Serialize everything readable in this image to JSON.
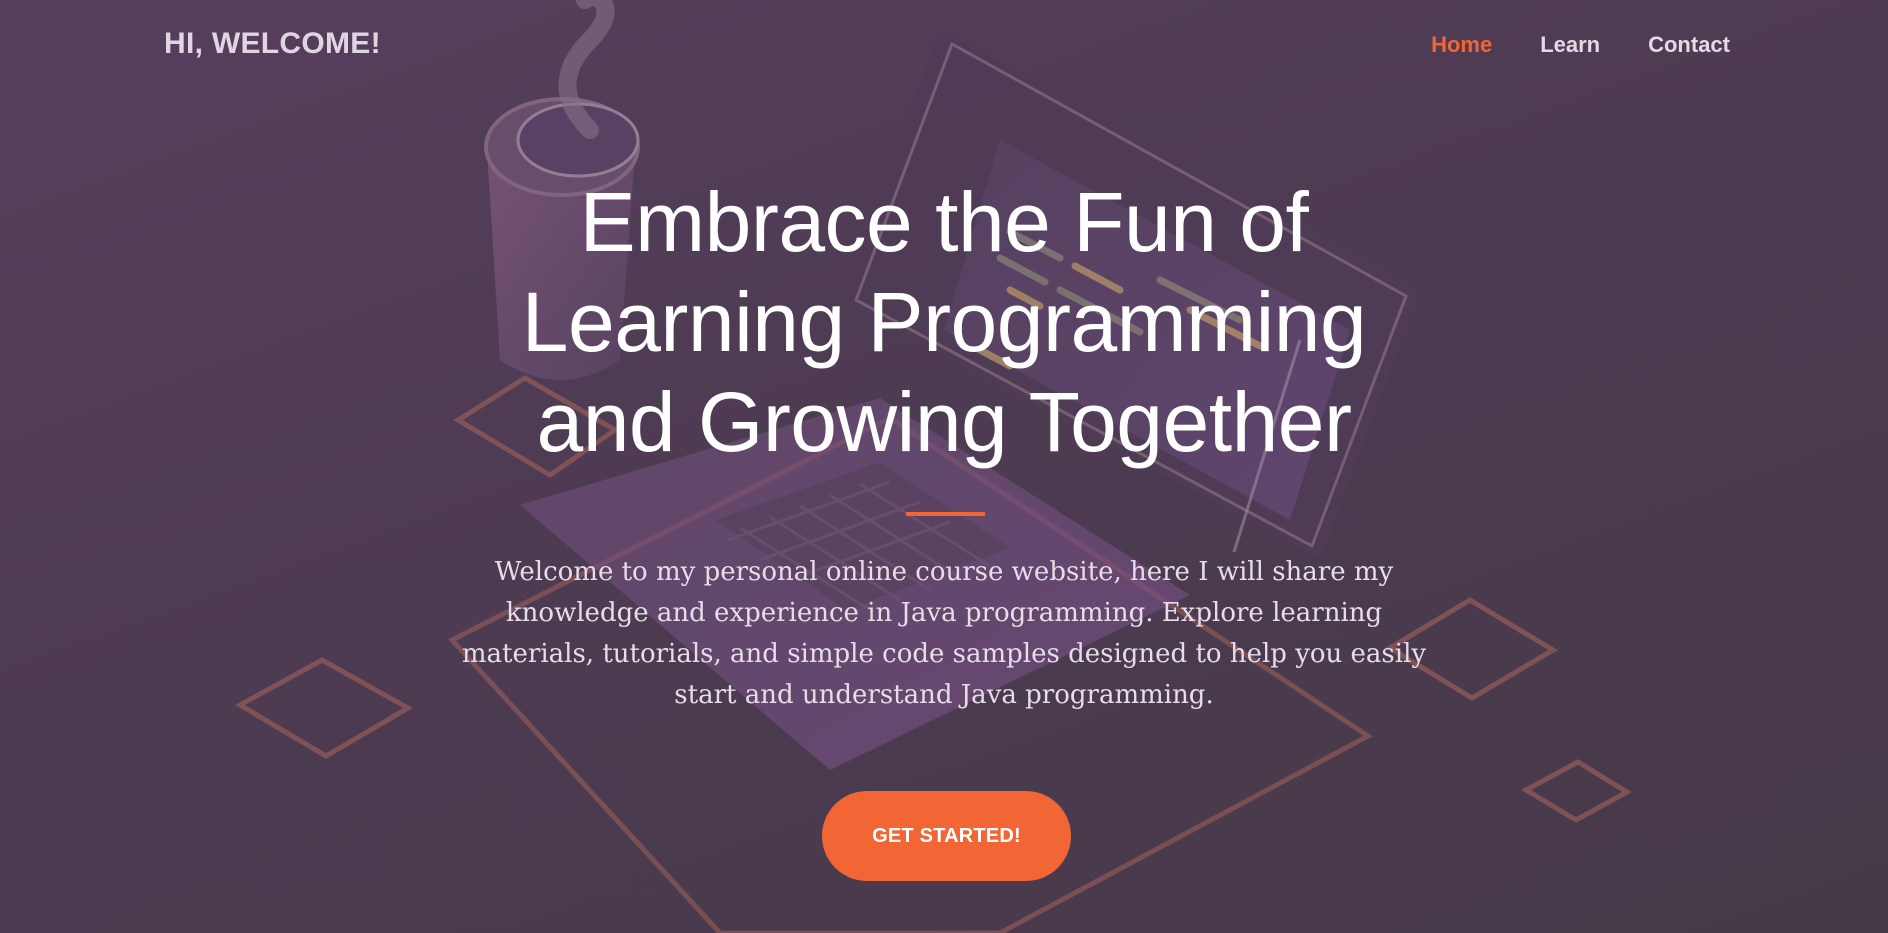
{
  "nav": {
    "brand": "HI, WELCOME!",
    "links": [
      {
        "label": "Home",
        "active": true
      },
      {
        "label": "Learn",
        "active": false
      },
      {
        "label": "Contact",
        "active": false
      }
    ]
  },
  "hero": {
    "title_lines": [
      "Embrace the Fun of",
      "Learning Programming",
      "and Growing Together"
    ],
    "description": "Welcome to my personal online course website, here I will share my knowledge and experience in Java programming. Explore learning materials, tutorials, and simple code samples designed to help you easily start and understand Java programming.",
    "cta_label": "GET STARTED!"
  },
  "colors": {
    "accent": "#f26535",
    "background": "#4d3b52",
    "text": "#ffffff"
  },
  "background_art": {
    "icons": [
      "laptop-illustration",
      "coffee-cup-illustration",
      "diamond-outline-shapes"
    ]
  }
}
